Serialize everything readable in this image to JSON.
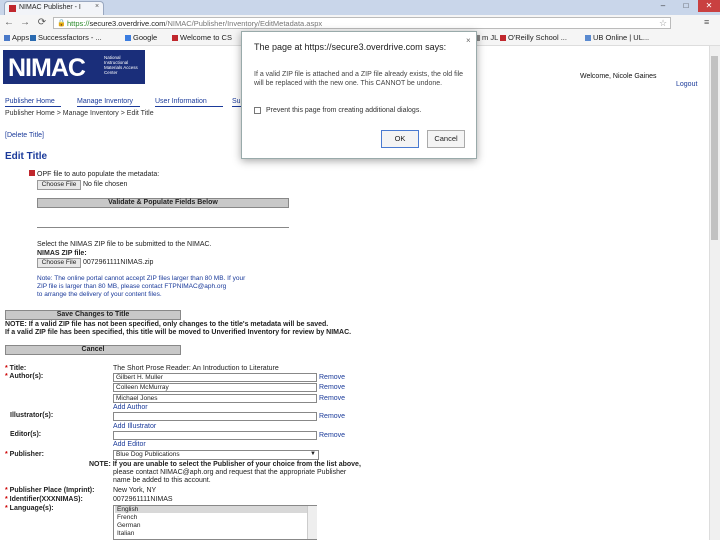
{
  "browser": {
    "tab_title": "NIMAC Publisher - I",
    "tab_close": "×",
    "url_protocol": "https://",
    "url_host": "secure3.overdrive.com",
    "url_path": "/NIMAC/Publisher/Inventory/EditMetadata.aspx",
    "minimize": "–",
    "maximize": "□",
    "close": "✕",
    "bookmarks": [
      {
        "label": "Apps",
        "color": "#4a79c8"
      },
      {
        "label": "Successfactors - ...",
        "color": "#2a6ab0"
      },
      {
        "label": "Google",
        "color": "#3b7de0"
      },
      {
        "label": "Welcome to CS",
        "color": "#c0272d"
      },
      {
        "label": "m JL",
        "color": "#888888"
      },
      {
        "label": "O'Reilly School ...",
        "color": "#c0272d"
      },
      {
        "label": "UB Online | UL...",
        "color": "#5a8ad0"
      }
    ]
  },
  "header": {
    "logo_text": "NIMAC",
    "logo_sub": "National Instructional Materials Access Center",
    "welcome": "Welcome, Nicole Gaines",
    "logout": "Logout"
  },
  "nav": {
    "tabs": [
      "Publisher Home",
      "Manage Inventory",
      "User Information",
      "Su"
    ]
  },
  "breadcrumb": "Publisher Home > Manage Inventory > Edit Title",
  "delete_title": "[Delete Title]",
  "page_title": "Edit Title",
  "opf": {
    "label": "OPF file to auto populate the metadata:",
    "choose_label": "Choose File",
    "no_file": "No file chosen",
    "validate_button": "Validate & Populate Fields Below"
  },
  "zip": {
    "instruction": "Select the NIMAS ZIP file to be submitted to the NIMAC.",
    "label": "NIMAS ZIP file:",
    "choose_label": "Choose File",
    "file_name": "0072961111NIMAS.zip",
    "note_lines": [
      "Note: The online portal cannot accept ZIP files larger than 80 MB. If your",
      "ZIP file is larger than 80 MB, please contact FTPNIMAC@aph.org",
      "to arrange the delivery of your content files."
    ]
  },
  "save_button": "Save Changes to Title",
  "save_notes": [
    "NOTE: If a valid ZIP file has not been specified, only changes to the title's metadata will be saved.",
    "If a valid ZIP file has been specified, this title will be moved to Unverified Inventory for review by NIMAC."
  ],
  "cancel_button": "Cancel",
  "form": {
    "title_label": "Title:",
    "title_value": "The Short Prose Reader: An Introduction to Literature",
    "authors_label": "Author(s):",
    "authors": [
      "Gilbert H. Muller",
      "Colleen McMurray",
      "Michael Jones"
    ],
    "remove": "Remove",
    "add_author": "Add Author",
    "illustrators_label": "Illustrator(s):",
    "add_illustrator": "Add Illustrator",
    "editors_label": "Editor(s):",
    "add_editor": "Add Editor",
    "publisher_label": "Publisher:",
    "publisher_value": "Blue Dog Publications",
    "publisher_note": [
      "NOTE: If you are unable to select the Publisher of your choice from the list above,",
      "please contact NIMAC@aph.org and request that the appropriate Publisher",
      "name be added to this account."
    ],
    "place_label": "Publisher Place (Imprint):",
    "place_value": "New York, NY",
    "identifier_label": "Identifier(XXXNIMAS):",
    "identifier_value": "0072961111NIMAS",
    "language_label": "Language(s):",
    "languages": [
      "English",
      "French",
      "German",
      "Italian"
    ]
  },
  "dialog": {
    "title": "The page at https://secure3.overdrive.com says:",
    "message": "If a valid ZIP file is attached and a ZIP file already exists, the old file will be replaced with the new one. This CANNOT be undone.",
    "checkbox_label": "Prevent this page from creating additional dialogs.",
    "ok": "OK",
    "cancel": "Cancel",
    "close": "×"
  },
  "colors": {
    "brand": "#1a2e7a",
    "link": "#1a3a9a",
    "required": "#cc0000"
  }
}
